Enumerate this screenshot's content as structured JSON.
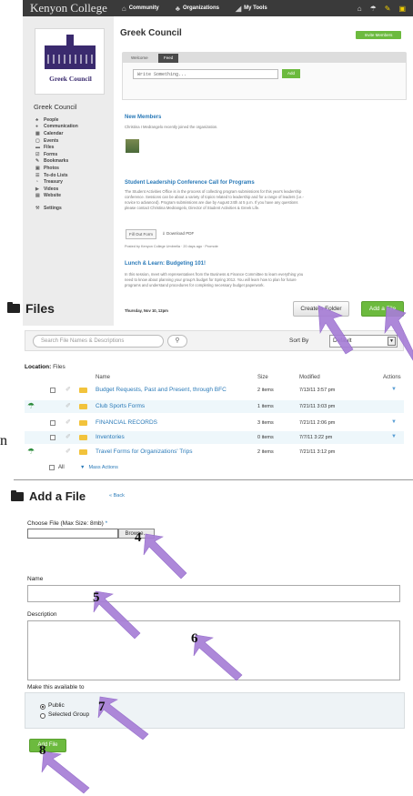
{
  "topbar": {
    "brand": "Kenyon College",
    "nav": [
      "Community",
      "Organizations",
      "My Tools"
    ]
  },
  "org": {
    "logo_text": "Greek Council",
    "name": "Greek Council",
    "sidebar_items": [
      "People",
      "Communication",
      "Calendar",
      "Events",
      "Files",
      "Forms",
      "Bookmarks",
      "Photos",
      "To-do Lists",
      "Treasury",
      "Videos",
      "Website",
      "Settings"
    ]
  },
  "feed": {
    "title": "Greek Council",
    "invite_label": "Invite Members",
    "tabs": [
      "Welcome",
      "Feed"
    ],
    "post_placeholder": "Write Something...",
    "post_button": "Add",
    "new_members_title": "New Members",
    "new_members_text": "Christina I Medrangelo recently joined the organization.",
    "slc_title": "Student Leadership Conference Call for Programs",
    "slc_text": "The Student Activities Office is in the process of collecting program submissions for this year's leadership conference. Sessions can be about a variety of topics related to leadership and for a range of leaders (i.e.- novice to advanced). Program submissions are due by August 24th at 5 p.m. If you have any questions please contact Christina Medrangelo, Director of Student Activities & Greek Life.",
    "fill_out": "Fill Out Form",
    "download": "Download PDF",
    "posted_by": "Posted by Kenyon College Umbrella · 20 days ago · Promote",
    "lunch_title": "Lunch & Learn: Budgeting 101!",
    "lunch_text": "In this session, meet with representatives from the Business & Finance Committee to learn everything you need to know about planning your group's budget for Spring 2012. You will learn how to plan for future programs and understand procedures for completing necessary budget paperwork.",
    "lunch_date": "Thursday, Nov 10, 12pm"
  },
  "files": {
    "title": "Files",
    "create_folder": "Create a Folder",
    "add_file": "Add a File",
    "search_placeholder": "Search File Names & Descriptions",
    "sort_label": "Sort By",
    "sort_value": "Default",
    "location_label": "Location:",
    "location_value": "Files",
    "columns": [
      "Name",
      "Size",
      "Modified",
      "Actions"
    ],
    "rows": [
      {
        "name": "Budget Requests, Past and Present, through BFC",
        "size": "2 items",
        "modified": "7/13/11 3:57 pm"
      },
      {
        "name": "Club Sports Forms",
        "size": "1 items",
        "modified": "7/21/11 3:03 pm"
      },
      {
        "name": "FINANCIAL RECORDS",
        "size": "3 items",
        "modified": "7/21/11 2:06 pm"
      },
      {
        "name": "Inventories",
        "size": "0 items",
        "modified": "7/7/11 3:22 pm"
      },
      {
        "name": "Travel Forms for Organizations' Trips",
        "size": "2 items",
        "modified": "7/21/11 3:12 pm"
      }
    ],
    "all_label": "All",
    "mass_actions": "Mass Actions"
  },
  "stray_letter": "n",
  "add_file_form": {
    "title": "Add a File",
    "back": "« Back",
    "choose_label": "Choose File (Max Size: 8mb)",
    "required_mark": "*",
    "browse": "Browse...",
    "name_label": "Name",
    "description_label": "Description",
    "availability_label": "Make this available to",
    "option_public": "Public",
    "option_selected": "Selected Group",
    "submit": "Add File"
  },
  "steps": [
    "4",
    "5",
    "6",
    "7",
    "8"
  ],
  "colors": {
    "accent_green": "#6cba3e",
    "link_blue": "#2a7ab8",
    "arrow": "#a77ed6"
  }
}
